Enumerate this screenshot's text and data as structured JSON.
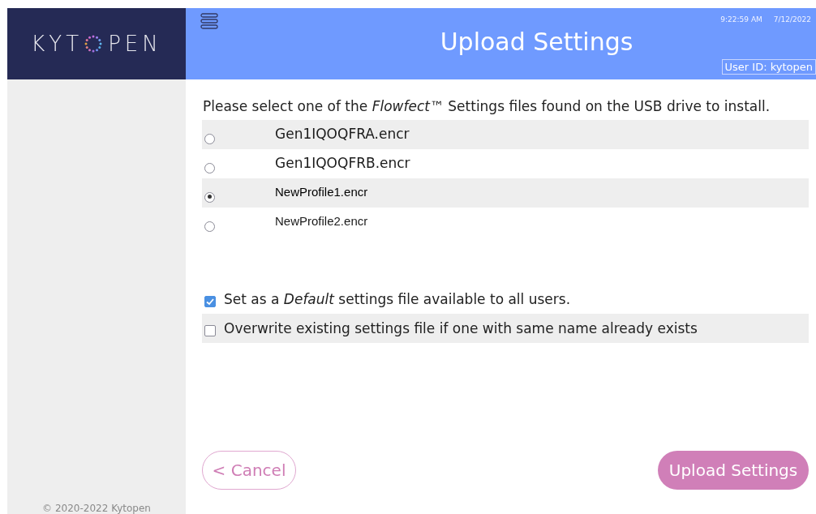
{
  "logo": {
    "left": "KYT",
    "right": "PEN"
  },
  "header": {
    "title": "Upload Settings",
    "time": "9:22:59 AM",
    "date": "7/12/2022",
    "user": "User ID: kytopen"
  },
  "instruction": "Please select one of the *Flowfect*™ Settings files found on the USB drive to install.",
  "files": [
    {
      "name": "Gen1IQOQFRA.encr",
      "kind": "gen",
      "selected": false
    },
    {
      "name": "Gen1IQOQFRB.encr",
      "kind": "gen",
      "selected": false
    },
    {
      "name": "NewProfile1.encr",
      "kind": "profile",
      "selected": true
    },
    {
      "name": "NewProfile2.encr",
      "kind": "profile",
      "selected": false
    }
  ],
  "options": [
    {
      "label": "Set as a *Default* settings file available to all users.",
      "checked": true
    },
    {
      "label": "Overwrite existing settings file if one with same name already exists",
      "checked": false
    }
  ],
  "buttons": {
    "cancel": "< Cancel",
    "upload": "Upload Settings"
  },
  "footer": "© 2020-2022 Kytopen"
}
